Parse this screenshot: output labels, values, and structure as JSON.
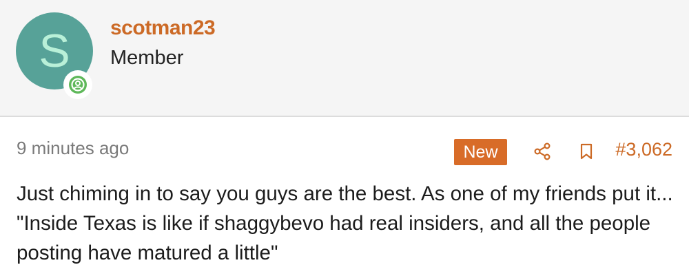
{
  "user": {
    "avatar_letter": "S",
    "username": "scotman23",
    "title": "Member",
    "avatar_color": "#57a298",
    "username_color": "#cc6a26",
    "online_icon": "person-circle-icon"
  },
  "post": {
    "timestamp": "9 minutes ago",
    "new_label": "New",
    "share_icon": "share-icon",
    "bookmark_icon": "bookmark-icon",
    "post_number": "#3,062",
    "accent_color": "#d86c28",
    "message": "Just chiming in to say you guys are the best. As one of my friends put it... \"Inside Texas is like if shaggybevo had real insiders, and all the people posting have matured a little\""
  }
}
